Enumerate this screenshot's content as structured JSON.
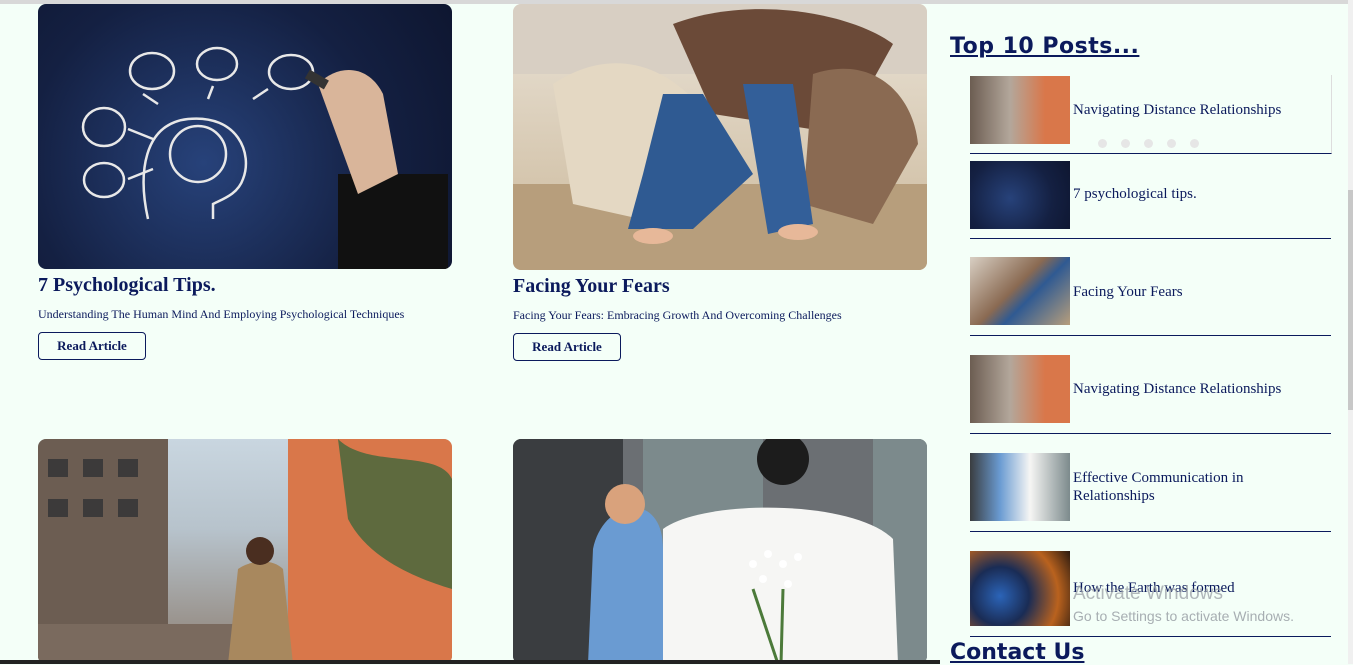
{
  "articles": [
    {
      "title": "7 Psychological Tips.",
      "subtitle": "Understanding The Human Mind And Employing Psychological Techniques",
      "button": "Read Article"
    },
    {
      "title": "Facing Your Fears",
      "subtitle": "Facing Your Fears: Embracing Growth And Overcoming Challenges",
      "button": "Read Article"
    }
  ],
  "sidebar": {
    "title": "Top 10 Posts...",
    "posts": [
      {
        "title": "Navigating Distance Relationships"
      },
      {
        "title": "7 psychological tips."
      },
      {
        "title": "Facing Your Fears"
      },
      {
        "title": "Navigating Distance Relationships"
      },
      {
        "title": "Effective Communication in Relationships"
      },
      {
        "title": "How the Earth was formed"
      }
    ],
    "contact_title": "Contact Us"
  },
  "watermark": {
    "line1": "Activate Windows",
    "line2": "Go to Settings to activate Windows."
  },
  "colors": {
    "background": "#f4fff8",
    "text": "#0b1a5c"
  }
}
